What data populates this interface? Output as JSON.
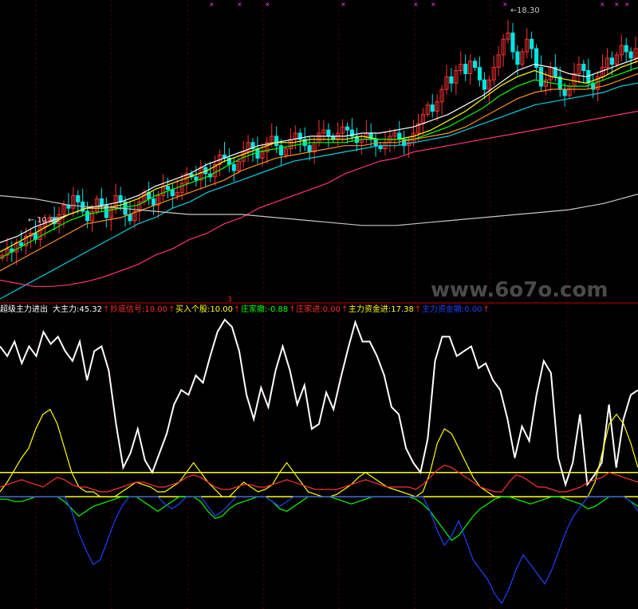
{
  "watermark": "www.6o7o.com",
  "price_labels": {
    "high": "18.30",
    "low": "10.99"
  },
  "indicator": {
    "name": "超级主力进出",
    "marker_glyph": "↑",
    "readouts": [
      {
        "text": "大主力:45.32",
        "color": "#ffffff"
      },
      {
        "text": "抄底信号:10.00",
        "color": "#ff3030"
      },
      {
        "text": "买入个股:10.00",
        "color": "#ffff00"
      },
      {
        "text": "庄家撤:-0.88",
        "color": "#00ff00"
      },
      {
        "text": "庄家进:0.00",
        "color": "#ff3030"
      },
      {
        "text": "主力资金进:17.38",
        "color": "#ffff00"
      },
      {
        "text": "主力资金撤:0.00",
        "color": "#2040ff"
      }
    ],
    "marker_top": "3"
  },
  "chart_data": [
    {
      "type": "candlestick",
      "title": "",
      "ylim": [
        9.5,
        18.8
      ],
      "high_label": 18.3,
      "low_label": 10.99,
      "up_color": "#ff3030",
      "down_color": "#00e5e5",
      "signal_color": "#ff40ff",
      "close": [
        10.9,
        11.1,
        11.0,
        11.3,
        11.2,
        11.5,
        11.6,
        11.4,
        11.8,
        12.0,
        12.1,
        11.9,
        12.2,
        12.5,
        12.4,
        12.8,
        12.6,
        12.3,
        12.0,
        12.3,
        12.7,
        12.5,
        12.1,
        12.4,
        12.8,
        12.6,
        12.2,
        12.0,
        12.3,
        12.6,
        12.9,
        12.7,
        12.5,
        12.8,
        13.1,
        13.0,
        12.8,
        12.9,
        13.2,
        13.5,
        13.4,
        13.3,
        13.7,
        13.5,
        13.4,
        13.8,
        14.1,
        14.0,
        13.8,
        13.6,
        13.9,
        14.2,
        14.5,
        14.3,
        14.0,
        14.2,
        14.5,
        14.7,
        14.4,
        14.1,
        14.3,
        14.6,
        14.8,
        14.6,
        14.4,
        14.2,
        14.5,
        14.8,
        14.9,
        14.7,
        14.6,
        14.8,
        15.0,
        14.9,
        14.7,
        14.5,
        14.6,
        14.8,
        14.6,
        14.4,
        14.3,
        14.5,
        14.7,
        14.8,
        14.6,
        14.4,
        14.5,
        14.8,
        15.1,
        15.4,
        15.7,
        15.5,
        15.8,
        16.2,
        16.6,
        16.4,
        16.8,
        17.0,
        16.7,
        17.1,
        16.9,
        16.5,
        16.2,
        16.5,
        16.9,
        17.3,
        17.8,
        18.0,
        17.4,
        17.0,
        17.4,
        17.8,
        17.5,
        16.9,
        16.3,
        16.5,
        16.9,
        16.6,
        16.2,
        16.0,
        16.3,
        16.7,
        17.0,
        16.8,
        16.4,
        16.2,
        16.6,
        16.9,
        17.2,
        17.0,
        17.3,
        17.6,
        17.4,
        17.2,
        17.5
      ],
      "volatility": 0.35,
      "ma_lines": [
        {
          "name": "",
          "color": "#ffffff",
          "values": [
            11.3,
            11.5,
            11.8,
            12.0,
            12.2,
            12.4,
            12.5,
            12.6,
            12.8,
            13.1,
            13.3,
            13.5,
            13.8,
            14.0,
            14.2,
            14.4,
            14.5,
            14.6,
            14.7,
            14.7,
            14.7,
            14.8,
            14.8,
            14.9,
            15.0,
            15.2,
            15.4,
            15.7,
            16.0,
            16.4,
            16.8,
            17.0,
            16.9,
            16.7,
            16.6,
            16.8,
            17.0,
            17.2
          ]
        },
        {
          "name": "",
          "color": "#ffff00",
          "values": [
            11.0,
            11.3,
            11.6,
            11.9,
            12.2,
            12.4,
            12.4,
            12.5,
            12.7,
            13.0,
            13.2,
            13.4,
            13.6,
            13.9,
            14.1,
            14.3,
            14.5,
            14.5,
            14.6,
            14.6,
            14.6,
            14.7,
            14.6,
            14.6,
            14.7,
            14.9,
            15.2,
            15.5,
            15.9,
            16.3,
            16.6,
            16.8,
            16.6,
            16.5,
            16.4,
            16.6,
            16.9,
            17.1
          ]
        },
        {
          "name": "",
          "color": "#00ff00",
          "values": [
            10.8,
            11.1,
            11.4,
            11.7,
            12.0,
            12.2,
            12.3,
            12.4,
            12.5,
            12.8,
            13.0,
            13.2,
            13.4,
            13.7,
            14.0,
            14.2,
            14.3,
            14.4,
            14.5,
            14.5,
            14.5,
            14.6,
            14.6,
            14.6,
            14.6,
            14.8,
            15.0,
            15.3,
            15.6,
            16.0,
            16.3,
            16.5,
            16.4,
            16.3,
            16.3,
            16.5,
            16.7,
            16.9
          ]
        },
        {
          "name": "",
          "color": "#ff9020",
          "values": [
            10.4,
            10.7,
            11.0,
            11.3,
            11.6,
            11.9,
            12.0,
            12.1,
            12.3,
            12.5,
            12.7,
            12.9,
            13.1,
            13.3,
            13.6,
            13.8,
            14.0,
            14.1,
            14.2,
            14.3,
            14.4,
            14.4,
            14.5,
            14.5,
            14.6,
            14.7,
            14.8,
            15.0,
            15.3,
            15.6,
            15.9,
            16.1,
            16.2,
            16.2,
            16.2,
            16.3,
            16.5,
            16.7
          ]
        },
        {
          "name": "",
          "color": "#00d0e0",
          "values": [
            9.5,
            9.8,
            10.1,
            10.4,
            10.7,
            11.0,
            11.3,
            11.6,
            11.9,
            12.1,
            12.4,
            12.6,
            12.9,
            13.1,
            13.3,
            13.5,
            13.7,
            13.9,
            14.0,
            14.1,
            14.2,
            14.3,
            14.4,
            14.4,
            14.5,
            14.6,
            14.7,
            14.9,
            15.1,
            15.3,
            15.5,
            15.7,
            15.8,
            15.9,
            16.0,
            16.1,
            16.3,
            16.4
          ]
        },
        {
          "name": "",
          "color": "#ff3080",
          "values": [
            10.1,
            10.0,
            9.9,
            9.9,
            9.95,
            10.05,
            10.2,
            10.4,
            10.6,
            10.9,
            11.1,
            11.4,
            11.6,
            11.9,
            12.1,
            12.4,
            12.6,
            12.8,
            13.0,
            13.2,
            13.5,
            13.7,
            13.9,
            14.0,
            14.2,
            14.3,
            14.4,
            14.5,
            14.6,
            14.7,
            14.8,
            14.9,
            15.0,
            15.1,
            15.2,
            15.3,
            15.4,
            15.5
          ]
        },
        {
          "name": "",
          "color": "#c8c8c8",
          "values": [
            12.8,
            12.75,
            12.7,
            12.6,
            12.5,
            12.45,
            12.45,
            12.4,
            12.35,
            12.3,
            12.25,
            12.2,
            12.2,
            12.2,
            12.2,
            12.15,
            12.1,
            12.05,
            12.0,
            11.95,
            11.9,
            11.85,
            11.85,
            11.85,
            11.9,
            11.95,
            12.0,
            12.05,
            12.1,
            12.15,
            12.2,
            12.25,
            12.3,
            12.35,
            12.45,
            12.55,
            12.7,
            12.85
          ]
        }
      ]
    },
    {
      "type": "line",
      "title": "超级主力进出",
      "ylim": [
        -45,
        75
      ],
      "hlines": [
        {
          "value": 10,
          "color": "#ffff00"
        },
        {
          "value": 0,
          "color": "#ffff00"
        }
      ],
      "series": [
        {
          "name": "大主力",
          "color": "#ffffff",
          "values": [
            62,
            58,
            64,
            55,
            62,
            58,
            68,
            63,
            66,
            60,
            56,
            64,
            48,
            60,
            62,
            52,
            30,
            12,
            18,
            28,
            15,
            10,
            18,
            26,
            38,
            44,
            42,
            50,
            47,
            58,
            68,
            73,
            70,
            60,
            42,
            32,
            45,
            37,
            52,
            62,
            52,
            38,
            46,
            28,
            30,
            43,
            36,
            49,
            61,
            72,
            64,
            64,
            58,
            50,
            37,
            34,
            20,
            14,
            10,
            24,
            56,
            66,
            66,
            58,
            60,
            62,
            53,
            55,
            48,
            44,
            32,
            16,
            29,
            23,
            42,
            56,
            51,
            16,
            5,
            14,
            34,
            5,
            9,
            14,
            38,
            12,
            32,
            42,
            44
          ]
        },
        {
          "name": "主力资金进",
          "color": "#ffff00",
          "values": [
            2,
            6,
            11,
            16,
            20,
            28,
            34,
            36,
            30,
            20,
            10,
            4,
            2,
            2,
            0,
            0,
            0,
            2,
            4,
            6,
            5,
            4,
            2,
            2,
            4,
            6,
            10,
            14,
            10,
            6,
            3,
            0,
            0,
            3,
            6,
            4,
            2,
            3,
            5,
            10,
            14,
            10,
            6,
            2,
            1,
            0,
            0,
            1,
            3,
            5,
            8,
            10,
            8,
            6,
            4,
            3,
            2,
            1,
            0,
            2,
            10,
            22,
            28,
            26,
            20,
            14,
            8,
            4,
            2,
            0,
            0,
            0,
            0,
            0,
            0,
            0,
            0,
            0,
            0,
            0,
            0,
            0,
            0,
            6,
            18,
            30,
            34,
            30,
            22,
            12
          ]
        },
        {
          "name": "庄家进",
          "color": "#ff3030",
          "values": [
            4,
            5,
            6,
            7,
            6,
            5,
            4,
            6,
            8,
            7,
            5,
            4,
            4,
            3,
            2,
            2,
            3,
            4,
            5,
            6,
            6,
            5,
            4,
            4,
            5,
            6,
            8,
            9,
            8,
            6,
            4,
            3,
            3,
            4,
            5,
            5,
            4,
            4,
            5,
            6,
            7,
            6,
            5,
            4,
            3,
            3,
            3,
            3,
            4,
            5,
            6,
            7,
            6,
            5,
            4,
            4,
            4,
            4,
            3,
            5,
            8,
            11,
            13,
            12,
            10,
            8,
            6,
            4,
            3,
            2,
            2,
            6,
            9,
            8,
            6,
            4,
            4,
            3,
            2,
            2,
            3,
            4,
            6,
            7,
            8,
            10,
            9,
            8,
            7,
            6
          ]
        },
        {
          "name": "庄家撤",
          "color": "#00ff00",
          "values": [
            -1,
            -1,
            -2,
            -2,
            -1,
            0,
            0,
            0,
            0,
            -2,
            -5,
            -8,
            -6,
            -4,
            -3,
            -2,
            -1,
            0,
            0,
            0,
            -2,
            -4,
            -6,
            -4,
            -2,
            0,
            0,
            0,
            -2,
            -6,
            -9,
            -8,
            -5,
            -3,
            -2,
            -1,
            0,
            0,
            -2,
            -5,
            -6,
            -4,
            -2,
            0,
            0,
            0,
            0,
            -1,
            -2,
            -3,
            -2,
            -1,
            0,
            0,
            0,
            0,
            0,
            0,
            -1,
            -3,
            -6,
            -10,
            -14,
            -18,
            -16,
            -12,
            -8,
            -5,
            -3,
            -1,
            0,
            0,
            -1,
            -2,
            -3,
            -2,
            -1,
            0,
            0,
            -1,
            -2,
            -3,
            -5,
            -4,
            -2,
            0,
            0,
            0,
            -2,
            -4
          ]
        },
        {
          "name": "主力资金撤",
          "color": "#2040ff",
          "values": [
            0,
            0,
            0,
            0,
            0,
            0,
            0,
            0,
            0,
            0,
            -6,
            -15,
            -22,
            -28,
            -26,
            -18,
            -10,
            -4,
            0,
            0,
            0,
            0,
            0,
            -3,
            -5,
            -3,
            0,
            0,
            0,
            -4,
            -8,
            -6,
            -3,
            0,
            0,
            0,
            0,
            0,
            -2,
            -4,
            -2,
            0,
            0,
            0,
            0,
            0,
            0,
            0,
            0,
            0,
            0,
            0,
            0,
            0,
            0,
            0,
            0,
            0,
            0,
            0,
            -6,
            -14,
            -20,
            -16,
            -10,
            -18,
            -26,
            -30,
            -34,
            -40,
            -44,
            -38,
            -30,
            -24,
            -28,
            -32,
            -36,
            -30,
            -22,
            -14,
            -8,
            -4,
            0,
            0,
            0,
            0,
            0,
            0,
            -2,
            -6
          ]
        }
      ]
    }
  ]
}
